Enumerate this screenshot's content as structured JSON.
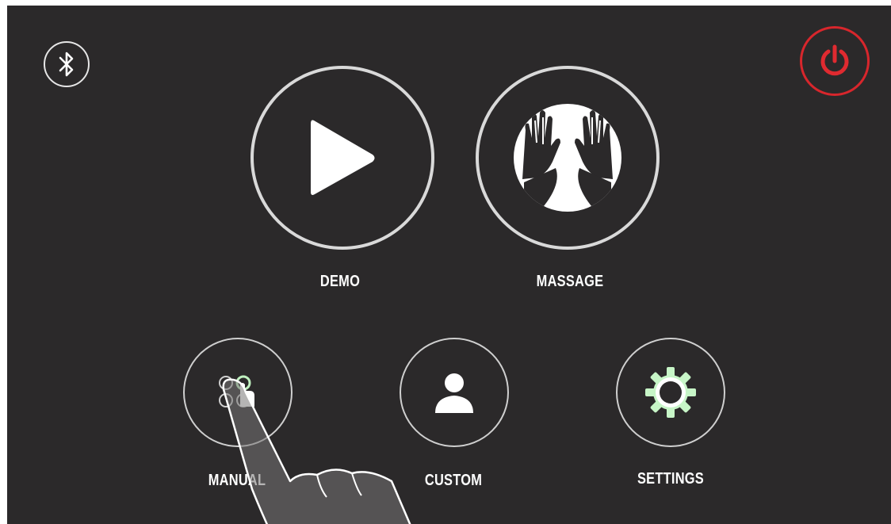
{
  "main": {
    "demo_label": "DEMO",
    "massage_label": "MASSAGE",
    "manual_label": "MANUAL",
    "custom_label": "CUSTOM",
    "settings_label": "SETTINGS"
  },
  "icons": {
    "bluetooth": "bluetooth-icon",
    "power": "power-icon",
    "demo": "play-icon",
    "massage": "massage-hands-icon",
    "manual": "manual-touch-icon",
    "custom": "user-icon",
    "settings": "gear-icon"
  },
  "colors": {
    "background": "#2b292a",
    "ring": "#d9d9d9",
    "power": "#d8262c",
    "settings_glow": "#c7f5c7"
  }
}
